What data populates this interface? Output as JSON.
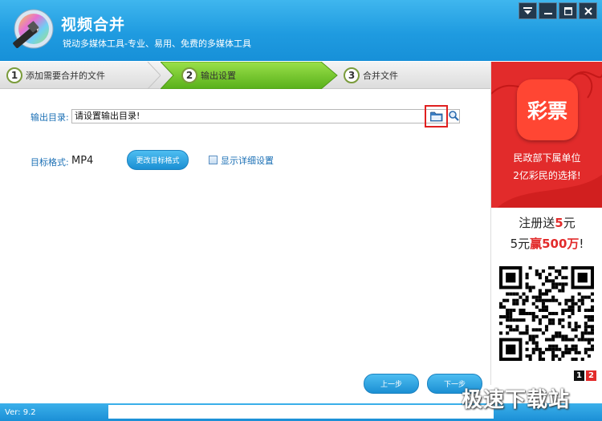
{
  "app": {
    "title": "视频合并",
    "subtitle": "锐动多媒体工具-专业、易用、免费的多媒体工具"
  },
  "steps": [
    {
      "num": "1",
      "label": "添加需要合并的文件",
      "active": false
    },
    {
      "num": "2",
      "label": "输出设置",
      "active": true
    },
    {
      "num": "3",
      "label": "合并文件",
      "active": false
    }
  ],
  "output": {
    "dir_label": "输出目录:",
    "dir_value": "请设置输出目录!",
    "format_label": "目标格式:",
    "format_value": "MP4",
    "change_format_button": "更改目标格式",
    "detail_label": "显示详细设置"
  },
  "nav": {
    "prev_button": "上一步",
    "next_button": "下一步"
  },
  "ad": {
    "logo_text": "彩票",
    "line1": "民政部下属单位",
    "line2": "2亿彩民的选择!",
    "promo1_a": "注册送",
    "promo1_b": "5",
    "promo1_c": "元",
    "promo2_a": "5元",
    "promo2_b": "赢500万",
    "promo2_c": "!",
    "page1": "1",
    "page2": "2"
  },
  "status": {
    "version": "Ver: 9.2"
  },
  "watermark": "极速下载站",
  "colors": {
    "titlebar": "#1f9be0",
    "active_step": "#73c62a",
    "accent_red": "#e22b2b",
    "label_blue": "#1a6fb5"
  }
}
